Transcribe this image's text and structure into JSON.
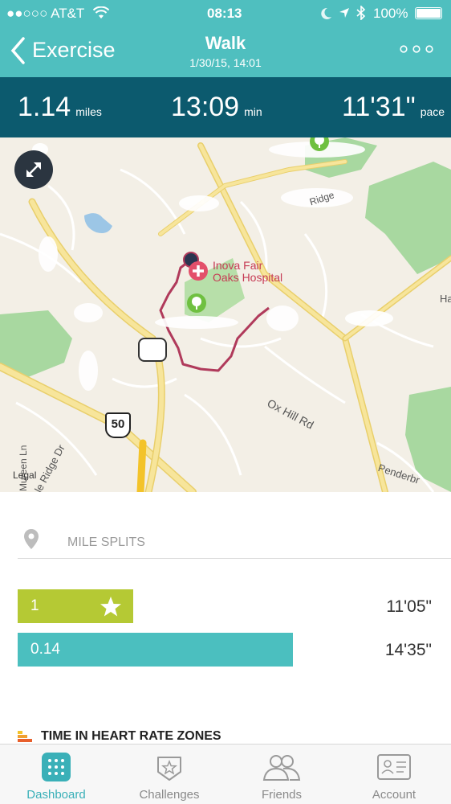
{
  "status_bar": {
    "carrier": "●●○○○ AT&T",
    "time": "08:13",
    "battery": "100%"
  },
  "nav": {
    "back_label": "Exercise",
    "title": "Walk",
    "subtitle": "1/30/15, 14:01",
    "more_icon": "more-dots-icon"
  },
  "stats": [
    {
      "value": "1.14",
      "unit": "miles"
    },
    {
      "value": "13:09",
      "unit": "min"
    },
    {
      "value": "11'31\"",
      "unit": "pace"
    }
  ],
  "map": {
    "hospital_label_line1": "Inova Fair",
    "hospital_label_line2": "Oaks Hospital",
    "road_ox_hill": "Ox Hill Rd",
    "route_50": "50",
    "road_penderbr": "Penderbr",
    "road_mureen": "Mureen Ln",
    "road_ridge_dr": "le Ridge Dr",
    "road_ridge_top": "Ridge",
    "road_ha": "Ha",
    "legal": "Legal",
    "route_color": "#b03a5b"
  },
  "splits": {
    "header": "MILE SPLITS",
    "items": [
      {
        "label": "1",
        "time": "11'05\"",
        "color": "#b5c934",
        "fraction": 0.267
      },
      {
        "label": "0.14",
        "time": "14'35\"",
        "color": "#4bbfbf",
        "fraction": 0.636
      }
    ]
  },
  "heart_rate": {
    "header": "TIME IN HEART RATE ZONES"
  },
  "tabs": [
    {
      "label": "Dashboard",
      "icon": "dashboard-grid-icon",
      "active": true
    },
    {
      "label": "Challenges",
      "icon": "star-badge-icon",
      "active": false
    },
    {
      "label": "Friends",
      "icon": "friends-icon",
      "active": false
    },
    {
      "label": "Account",
      "icon": "id-card-icon",
      "active": false
    }
  ],
  "colors": {
    "teal": "#4fbfbf",
    "dark_teal": "#0c5a6e",
    "lime": "#b5c934",
    "active_tab": "#3ab0b8"
  }
}
